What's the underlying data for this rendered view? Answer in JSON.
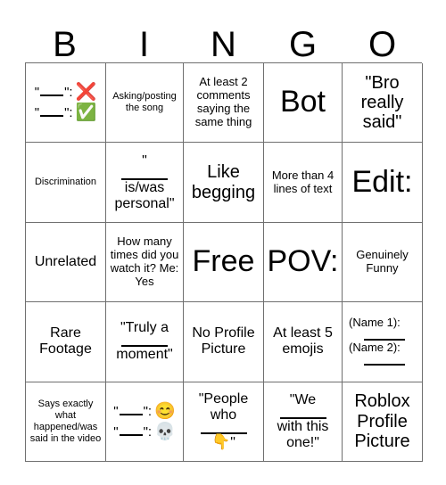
{
  "header": {
    "letters": [
      "B",
      "I",
      "N",
      "G",
      "O"
    ]
  },
  "grid": {
    "rows": 5,
    "columns": 5,
    "border_color": "#6f6f6f"
  },
  "cells": [
    {
      "id": "r1c1",
      "type": "quote-emoji-pair",
      "lines": [
        {
          "quote_open": "\"",
          "blank": "____",
          "quote_close": "\":",
          "emoji": "❌",
          "emoji_name": "cross-mark-emoji"
        },
        {
          "quote_open": "\"",
          "blank": "____",
          "quote_close": "\":",
          "emoji": "✅",
          "emoji_name": "check-mark-button-emoji"
        }
      ],
      "text": "\"____\": ❌ \"____\": ✅"
    },
    {
      "id": "r1c2",
      "type": "text",
      "text": "Asking/posting the song",
      "size": "xs"
    },
    {
      "id": "r1c3",
      "type": "text",
      "text": "At least 2 comments saying the same thing",
      "size": "s"
    },
    {
      "id": "r1c4",
      "type": "text",
      "text": "Bot",
      "size": "xxl"
    },
    {
      "id": "r1c5",
      "type": "text",
      "text": "\"Bro really said\"",
      "size": "l"
    },
    {
      "id": "r2c1",
      "type": "text",
      "text": "Discrimination",
      "size": "xs"
    },
    {
      "id": "r2c2",
      "type": "quote-blank-text",
      "prefix": "\"",
      "blank": "_____",
      "suffix": "is/was personal\"",
      "text": "\"_____ is/was personal\"",
      "size": "m"
    },
    {
      "id": "r2c3",
      "type": "text",
      "text": "Like begging",
      "size": "l"
    },
    {
      "id": "r2c4",
      "type": "text",
      "text": "More than 4 lines of text",
      "size": "s"
    },
    {
      "id": "r2c5",
      "type": "text",
      "text": "Edit:",
      "size": "xxl"
    },
    {
      "id": "r3c1",
      "type": "text",
      "text": "Unrelated",
      "size": "m"
    },
    {
      "id": "r3c2",
      "type": "text",
      "text": "How many times did you watch it? Me: Yes",
      "size": "s"
    },
    {
      "id": "r3c3",
      "type": "text",
      "text": "Free",
      "size": "xxl",
      "free_space": true
    },
    {
      "id": "r3c4",
      "type": "text",
      "text": "POV:",
      "size": "xxl"
    },
    {
      "id": "r3c5",
      "type": "text",
      "text": "Genuinely Funny",
      "size": "s"
    },
    {
      "id": "r4c1",
      "type": "text",
      "text": "Rare Footage",
      "size": "m"
    },
    {
      "id": "r4c2",
      "type": "quote-blank-text",
      "prefix": "\"Truly a",
      "blank": "_____",
      "suffix": "moment\"",
      "text": "\"Truly a _____ moment\"",
      "size": "m"
    },
    {
      "id": "r4c3",
      "type": "text",
      "text": "No Profile Picture",
      "size": "m"
    },
    {
      "id": "r4c4",
      "type": "text",
      "text": "At least 5 emojis",
      "size": "m"
    },
    {
      "id": "r4c5",
      "type": "names",
      "name1_label": "(Name 1):",
      "name1_blank": "____",
      "name2_label": "(Name 2):",
      "name2_blank": "____",
      "text": "(Name 1): ____ (Name 2): ____"
    },
    {
      "id": "r5c1",
      "type": "text",
      "text": "Says exactly what happened/was said in the video",
      "size": "xs"
    },
    {
      "id": "r5c2",
      "type": "quote-emoji-pair",
      "lines": [
        {
          "quote_open": "\"",
          "blank": "____",
          "quote_close": "\":",
          "emoji": "😊",
          "emoji_name": "smiling-face-with-smiling-eyes-emoji"
        },
        {
          "quote_open": "\"",
          "blank": "____",
          "quote_close": "\":",
          "emoji": "💀",
          "emoji_name": "skull-emoji"
        }
      ],
      "text": "\"____\": 😊 \"____\": 💀"
    },
    {
      "id": "r5c3",
      "type": "quote-blank-emoji",
      "prefix": "\"People who",
      "blank": "_____",
      "emoji": "👇",
      "emoji_name": "backhand-index-pointing-down-emoji",
      "suffix": "\"",
      "text": "\"People who _____ 👇\"",
      "size": "m"
    },
    {
      "id": "r5c4",
      "type": "quote-blank-text",
      "prefix": "\"We",
      "blank": "_____",
      "suffix": "with this one!\"",
      "text": "\"We _____ with this one!\"",
      "size": "s"
    },
    {
      "id": "r5c5",
      "type": "text",
      "text": "Roblox Profile Picture",
      "size": "l"
    }
  ]
}
